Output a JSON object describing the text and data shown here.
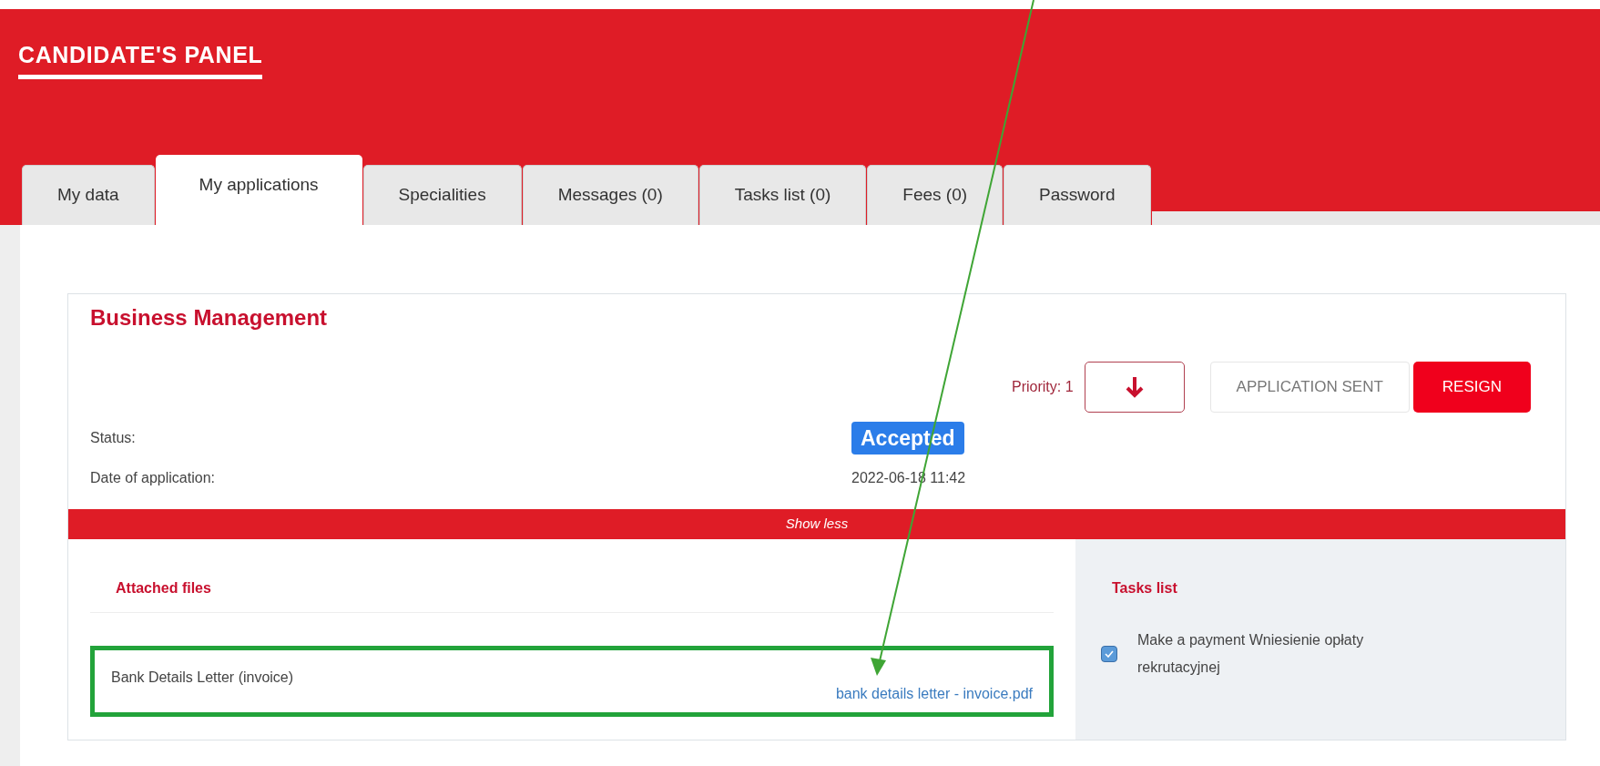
{
  "header": {
    "title": "CANDIDATE'S PANEL"
  },
  "tabs": [
    {
      "label": "My data",
      "selected": false
    },
    {
      "label": "My applications",
      "selected": true
    },
    {
      "label": "Specialities",
      "selected": false
    },
    {
      "label": "Messages (0)",
      "selected": false
    },
    {
      "label": "Tasks list (0)",
      "selected": false
    },
    {
      "label": "Fees (0)",
      "selected": false
    },
    {
      "label": "Password",
      "selected": false
    }
  ],
  "application": {
    "title": "Business Management",
    "priority": "Priority: 1",
    "status_button": "APPLICATION SENT",
    "resign_button": "RESIGN",
    "fields": [
      {
        "label": "Status:",
        "value": "Accepted",
        "kind": "badge"
      },
      {
        "label": "Date of application:",
        "value": "2022-06-18 11:42",
        "kind": "text"
      }
    ],
    "toggle": "Show less",
    "attached_files": {
      "heading": "Attached files",
      "files": [
        {
          "name": "Bank Details Letter (invoice)",
          "link": "bank details letter - invoice.pdf",
          "highlighted": true
        }
      ]
    },
    "tasks": {
      "heading": "Tasks list",
      "items": [
        {
          "text": "Make a payment Wniesienie opłaty rekrutacyjnej",
          "checked": true
        }
      ]
    }
  },
  "annotation": {
    "arrow": true
  }
}
